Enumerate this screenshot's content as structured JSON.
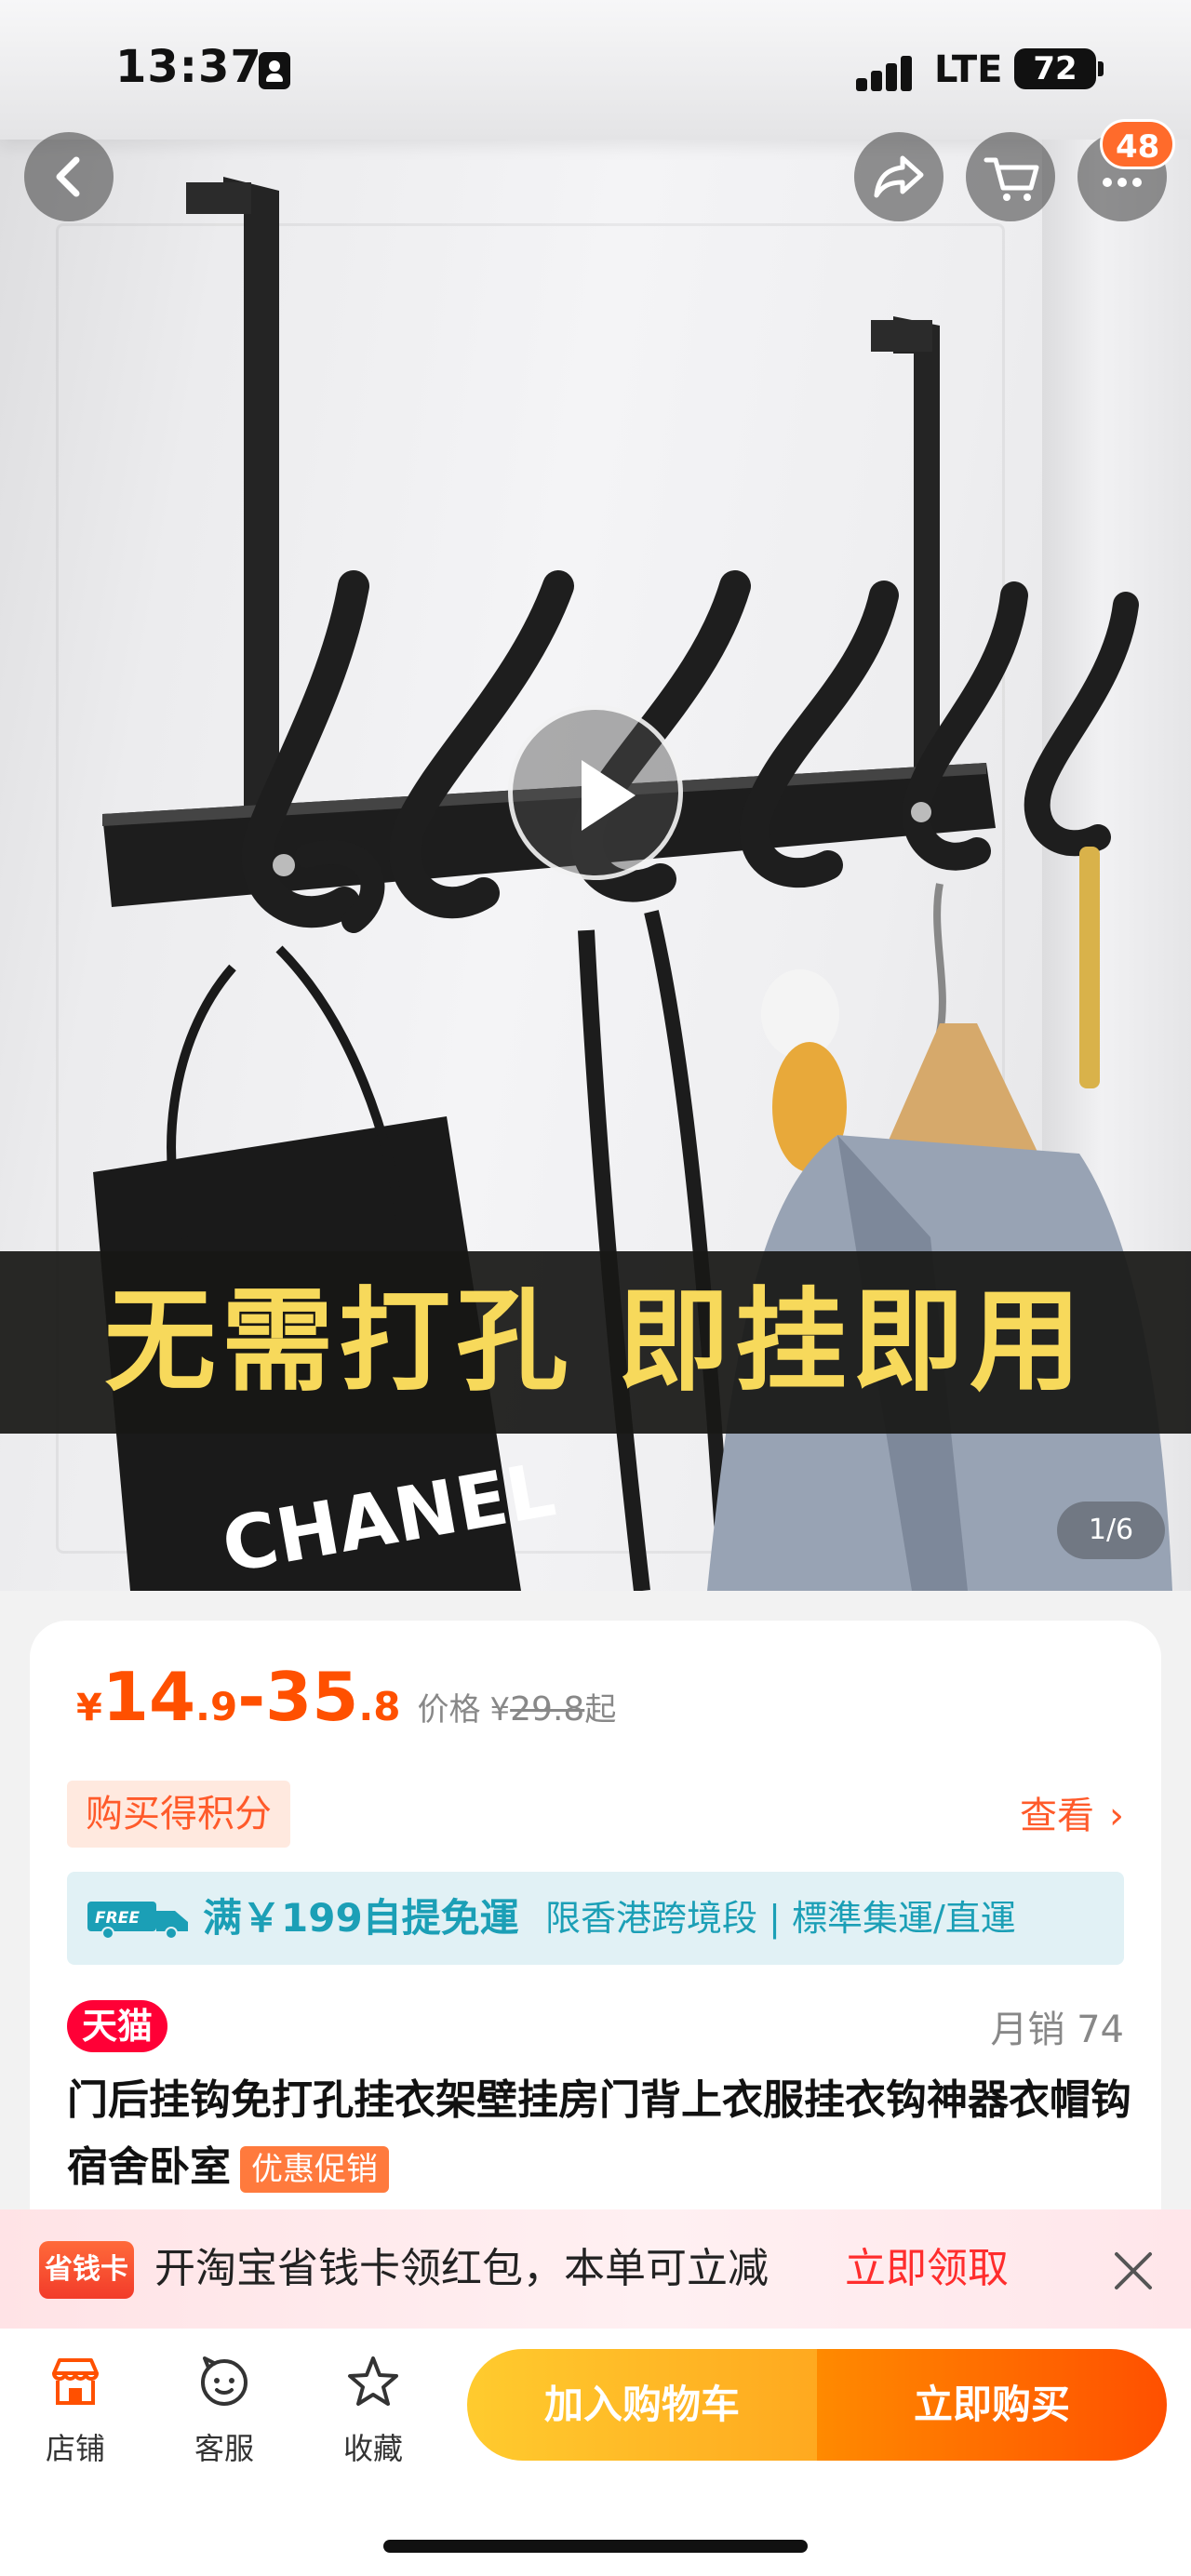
{
  "status_bar": {
    "time": "13:37",
    "network": "LTE",
    "battery": "72"
  },
  "header": {
    "cart_badge": "48"
  },
  "gallery": {
    "banner_text": "无需打孔 即挂即用",
    "page_indicator": "1/6",
    "brand_text": "CHANEL"
  },
  "price": {
    "currency": "¥",
    "low_int": "14",
    "low_dec": ".9",
    "dash": "-",
    "high_int": "35",
    "high_dec": ".8",
    "label": "价格",
    "orig_currency": "¥",
    "original": "29.8",
    "suffix": "起"
  },
  "points": {
    "tag": "购买得积分",
    "link": "查看"
  },
  "shipping": {
    "free_badge": "FREE",
    "main": "满￥199自提免運",
    "detail": "限香港跨境段 | 標準集運/直運"
  },
  "product": {
    "store_badge": "天猫",
    "sales": "月销 74",
    "title": "门后挂钩免打孔挂衣架壁挂房门背上衣服挂衣钩神器衣帽钩宿舍卧室",
    "promo_tag": "优惠促销"
  },
  "coupon": {
    "logo": "省钱卡",
    "text": "开淘宝省钱卡领红包，本单可立减",
    "cta": "立即领取"
  },
  "actions": {
    "store": "店铺",
    "service": "客服",
    "favorite": "收藏",
    "add_cart": "加入购物车",
    "buy_now": "立即购买"
  },
  "colors": {
    "accent": "#ff5000",
    "tmall": "#ff0036",
    "shipping": "#1b9fb6",
    "banner_text": "#f7d95b"
  }
}
